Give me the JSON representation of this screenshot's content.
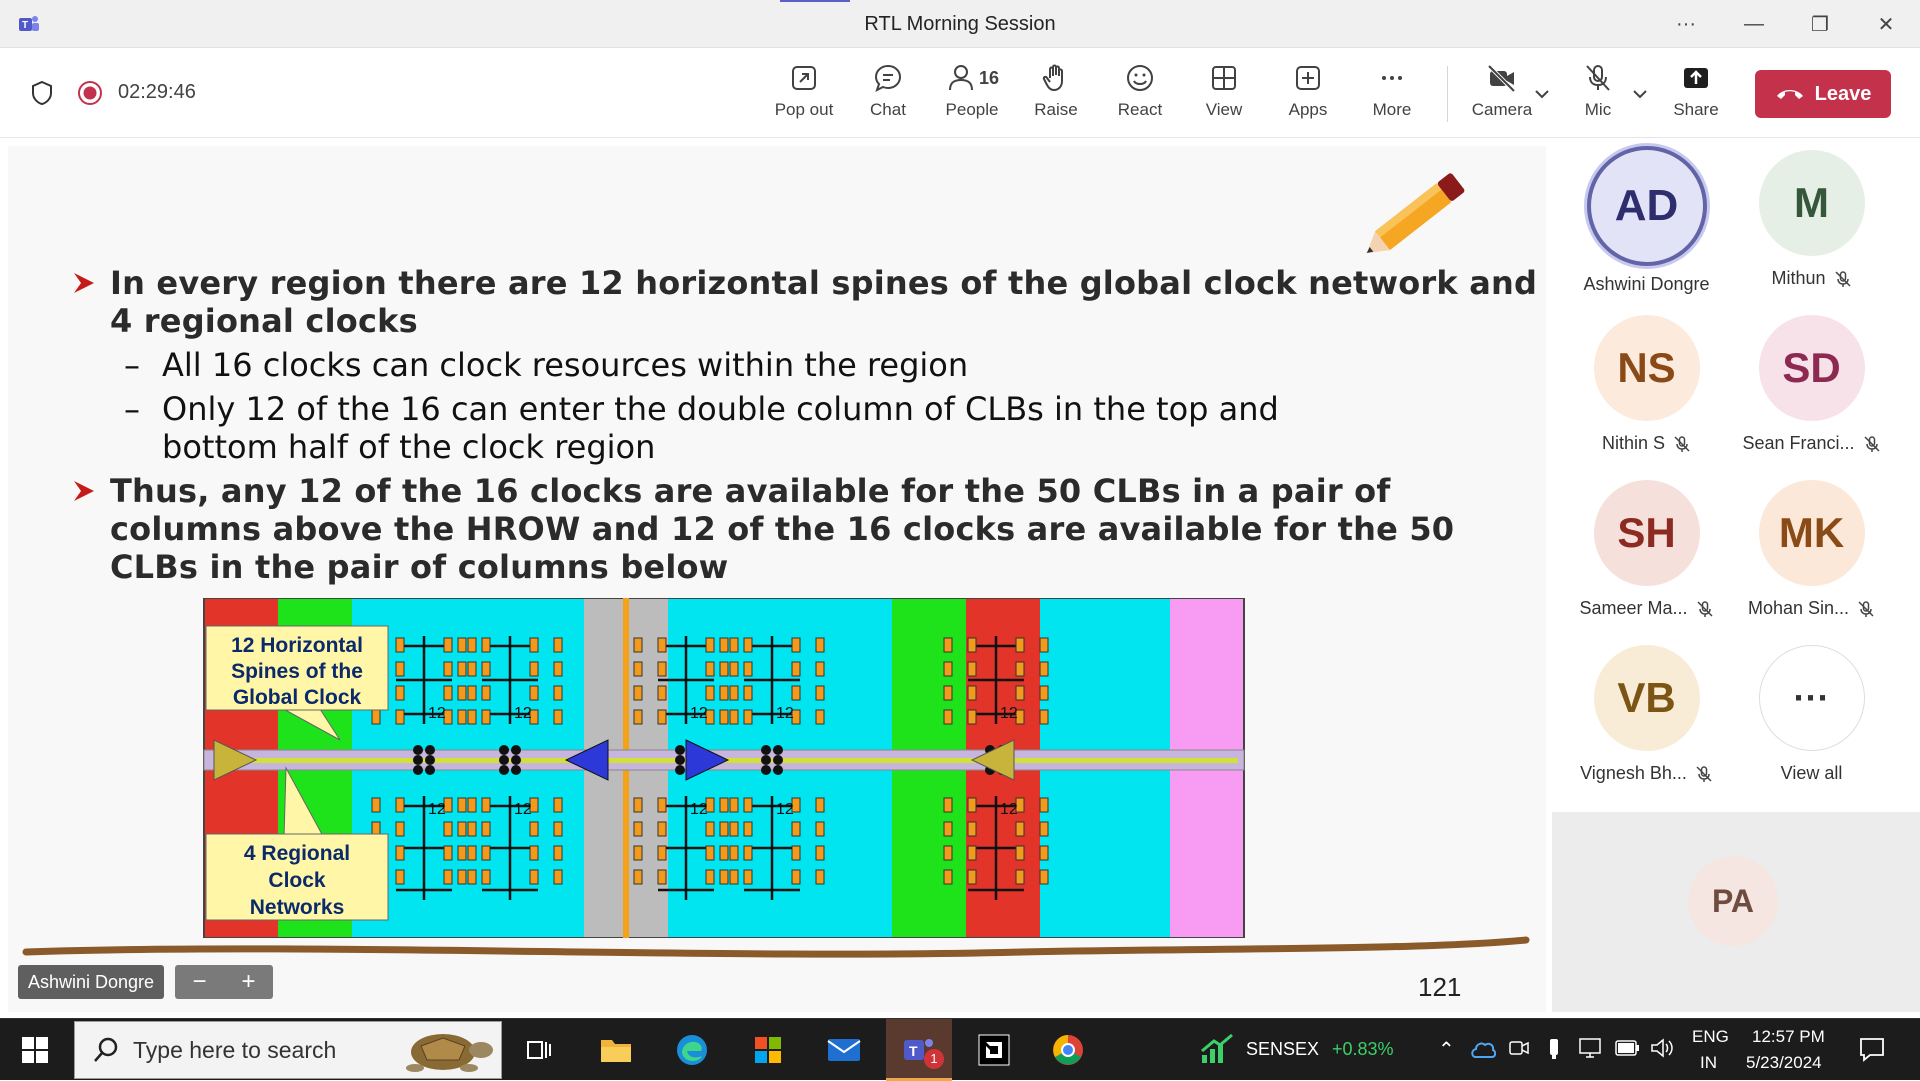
{
  "window": {
    "title": "RTL Morning Session"
  },
  "meeting": {
    "timer": "02:29:46",
    "people_count": "16"
  },
  "toolbar": {
    "popout": "Pop out",
    "chat": "Chat",
    "people": "People",
    "raise": "Raise",
    "react": "React",
    "view": "View",
    "apps": "Apps",
    "more": "More",
    "camera": "Camera",
    "mic": "Mic",
    "share": "Share",
    "leave": "Leave"
  },
  "slide": {
    "bullet1": "In every region there are 12 horizontal spines of the global clock network and",
    "bullet1b": "4 regional clocks",
    "sub1": "All 16 clocks can clock resources within the region",
    "sub2a": "Only 12 of the 16 can enter the double column of CLBs in the top and",
    "sub2b": "bottom half of the clock region",
    "bullet2a": "Thus, any 12 of the 16 clocks are available for the 50 CLBs in a pair of",
    "bullet2b": "columns above the HROW and 12 of the 16 clocks are available for the 50",
    "bullet2c": "CLBs in the pair of columns below",
    "callout1": [
      "12 Horizontal",
      "Spines of the",
      "Global Clock"
    ],
    "callout2": [
      "4 Regional",
      "Clock",
      "Networks"
    ],
    "tree_label": "12",
    "page_number": "121",
    "presenter": "Ashwini Dongre",
    "zoom_minus": "−",
    "zoom_plus": "+"
  },
  "participants": [
    {
      "initials": "AD",
      "name": "Ashwini Dongre",
      "bg": "#e3e3f8",
      "fg": "#2e2e6e",
      "muted": false,
      "speaking": true
    },
    {
      "initials": "M",
      "name": "Mithun",
      "bg": "#e6efe6",
      "fg": "#37573a",
      "muted": true
    },
    {
      "initials": "NS",
      "name": "Nithin S",
      "bg": "#fcebdc",
      "fg": "#8a4a17",
      "muted": true
    },
    {
      "initials": "SD",
      "name": "Sean Franci...",
      "bg": "#f8e2ea",
      "fg": "#8c2a52",
      "muted": true
    },
    {
      "initials": "SH",
      "name": "Sameer Ma...",
      "bg": "#f6e0dc",
      "fg": "#8c2b21",
      "muted": true
    },
    {
      "initials": "MK",
      "name": "Mohan Sin...",
      "bg": "#fbe8d9",
      "fg": "#8a4b17",
      "muted": true
    },
    {
      "initials": "VB",
      "name": "Vignesh Bh...",
      "bg": "#f9ecd7",
      "fg": "#7c5514",
      "muted": true
    },
    {
      "initials": "···",
      "name": "View all",
      "bg": "#ffffff",
      "fg": "#333333",
      "muted": false
    }
  ],
  "pa_tile": {
    "initials": "PA"
  },
  "taskbar": {
    "search_placeholder": "Type here to search",
    "teams_badge": "1",
    "sensex_label": "SENSEX",
    "sensex_change": "+0.83%",
    "lang1": "ENG",
    "lang2": "IN",
    "time": "12:57 PM",
    "date": "5/23/2024"
  },
  "colors": {
    "leave": "#c4314b",
    "accent": "#5b5fc7",
    "sensex_up": "#3ccf6a"
  }
}
